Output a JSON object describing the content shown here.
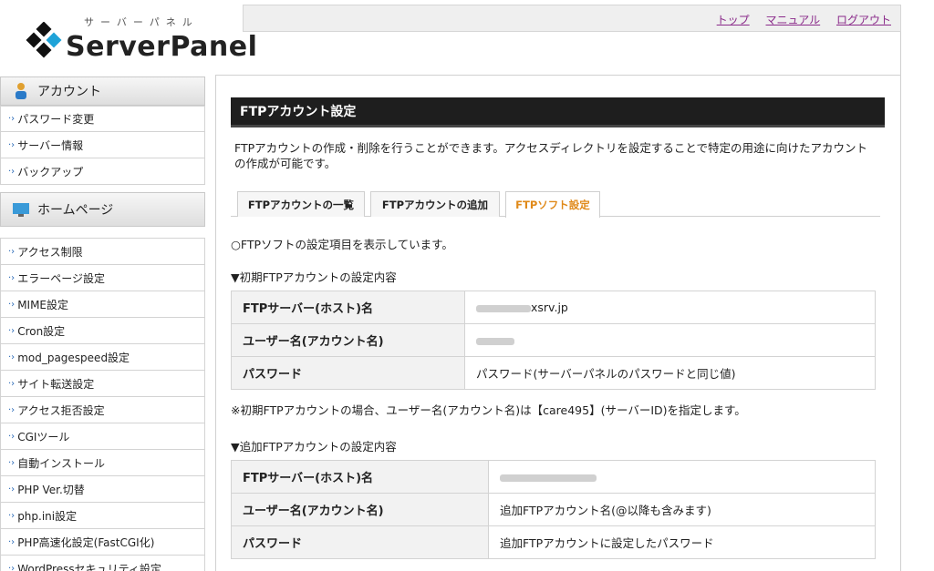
{
  "logo": {
    "kana": "サーバーパネル",
    "name": "ServerPanel"
  },
  "topnav": {
    "top": "トップ",
    "manual": "マニュアル",
    "logout": "ログアウト"
  },
  "sidebar": {
    "account_title": "アカウント",
    "account_items": [
      "パスワード変更",
      "サーバー情報",
      "バックアップ"
    ],
    "homepage_title": "ホームページ",
    "homepage_items": [
      "アクセス制限",
      "エラーページ設定",
      "MIME設定",
      "Cron設定",
      "mod_pagespeed設定",
      "サイト転送設定",
      "アクセス拒否設定",
      "CGIツール",
      "自動インストール",
      "PHP Ver.切替",
      "php.ini設定",
      "PHP高速化設定(FastCGI化)",
      "WordPressセキュリティ設定"
    ]
  },
  "main": {
    "title": "FTPアカウント設定",
    "description": "FTPアカウントの作成・削除を行うことができます。アクセスディレクトリを設定することで特定の用途に向けたアカウントの作成が可能です。",
    "tabs": [
      "FTPアカウントの一覧",
      "FTPアカウントの追加",
      "FTPソフト設定"
    ],
    "notice": "○FTPソフトの設定項目を表示しています。",
    "initial_label": "▼初期FTPアカウントの設定内容",
    "initial_rows": [
      {
        "key": "FTPサーバー(ホスト)名",
        "value": "xsrv.jp"
      },
      {
        "key": "ユーザー名(アカウント名)",
        "value": ""
      },
      {
        "key": "パスワード",
        "value": "パスワード(サーバーパネルのパスワードと同じ値)"
      }
    ],
    "note": "※初期FTPアカウントの場合、ユーザー名(アカウント名)は【care495】(サーバーID)を指定します。",
    "added_label": "▼追加FTPアカウントの設定内容",
    "added_rows": [
      {
        "key": "FTPサーバー(ホスト)名",
        "value": ""
      },
      {
        "key": "ユーザー名(アカウント名)",
        "value": "追加FTPアカウント名(@以降も含みます)"
      },
      {
        "key": "パスワード",
        "value": "追加FTPアカウントに設定したパスワード"
      }
    ]
  },
  "colors": {
    "accent": "#e08a1a",
    "title_bg": "#1e1e1e",
    "link": "#8a2a8a"
  }
}
